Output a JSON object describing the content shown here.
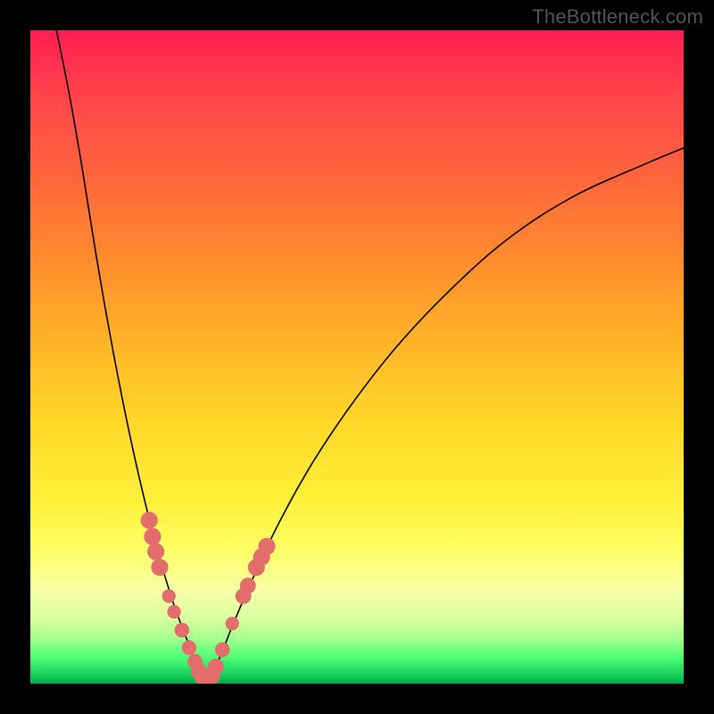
{
  "watermark": {
    "text": "TheBottleneck.com"
  },
  "chart_data": {
    "type": "line",
    "title": "",
    "xlabel": "",
    "ylabel": "",
    "xlim": [
      0,
      100
    ],
    "ylim": [
      0,
      100
    ],
    "grid": false,
    "legend": false,
    "background": {
      "gradient_axis": "vertical",
      "stops": [
        {
          "pos": 0.0,
          "color": "#ff1f54"
        },
        {
          "pos": 0.2,
          "color": "#ff6a3a"
        },
        {
          "pos": 0.4,
          "color": "#ffb528"
        },
        {
          "pos": 0.6,
          "color": "#ffe838"
        },
        {
          "pos": 0.8,
          "color": "#fdff6a"
        },
        {
          "pos": 0.92,
          "color": "#b8ff95"
        },
        {
          "pos": 1.0,
          "color": "#0aa24a"
        }
      ]
    },
    "series": [
      {
        "name": "left-branch",
        "color": "#000000",
        "width": 1.6,
        "x": [
          4.0,
          6.0,
          8.0,
          10.0,
          12.0,
          14.0,
          16.0,
          18.0,
          20.0,
          22.0,
          23.5,
          25.0,
          26.0
        ],
        "y": [
          100.0,
          90.0,
          78.5,
          66.0,
          54.5,
          44.0,
          34.5,
          26.0,
          18.5,
          12.0,
          8.0,
          4.0,
          1.0
        ]
      },
      {
        "name": "right-branch",
        "color": "#000000",
        "width": 1.6,
        "x": [
          27.5,
          29.0,
          31.0,
          34.0,
          38.0,
          43.0,
          49.0,
          56.0,
          64.0,
          73.0,
          83.0,
          94.0,
          100.0
        ],
        "y": [
          1.0,
          4.0,
          9.0,
          16.0,
          24.5,
          33.5,
          42.5,
          51.5,
          60.0,
          68.0,
          74.5,
          79.5,
          82.0
        ]
      },
      {
        "name": "valley-floor",
        "color": "#06b24f",
        "width": 0,
        "x": [
          26.0,
          26.5,
          27.0,
          27.5
        ],
        "y": [
          1.0,
          0.4,
          0.4,
          1.0
        ]
      }
    ],
    "scatter": {
      "name": "markers",
      "color": "#e36d6d",
      "points": [
        {
          "x": 18.2,
          "y": 25.0,
          "r": 3.0
        },
        {
          "x": 18.7,
          "y": 22.5,
          "r": 3.0
        },
        {
          "x": 19.2,
          "y": 20.2,
          "r": 3.0
        },
        {
          "x": 19.8,
          "y": 17.8,
          "r": 3.0
        },
        {
          "x": 21.2,
          "y": 13.4,
          "r": 2.4
        },
        {
          "x": 22.0,
          "y": 11.0,
          "r": 2.4
        },
        {
          "x": 23.2,
          "y": 8.2,
          "r": 2.6
        },
        {
          "x": 24.3,
          "y": 5.5,
          "r": 2.6
        },
        {
          "x": 25.2,
          "y": 3.4,
          "r": 2.6
        },
        {
          "x": 25.8,
          "y": 1.9,
          "r": 2.8
        },
        {
          "x": 26.4,
          "y": 1.0,
          "r": 3.0
        },
        {
          "x": 27.0,
          "y": 0.7,
          "r": 3.0
        },
        {
          "x": 27.7,
          "y": 1.2,
          "r": 3.0
        },
        {
          "x": 28.4,
          "y": 2.6,
          "r": 2.8
        },
        {
          "x": 29.4,
          "y": 5.2,
          "r": 2.6
        },
        {
          "x": 30.9,
          "y": 9.2,
          "r": 2.4
        },
        {
          "x": 32.6,
          "y": 13.4,
          "r": 2.8
        },
        {
          "x": 33.3,
          "y": 15.0,
          "r": 2.8
        },
        {
          "x": 34.6,
          "y": 17.8,
          "r": 3.0
        },
        {
          "x": 35.4,
          "y": 19.4,
          "r": 3.0
        },
        {
          "x": 36.2,
          "y": 21.0,
          "r": 3.0
        }
      ]
    }
  }
}
